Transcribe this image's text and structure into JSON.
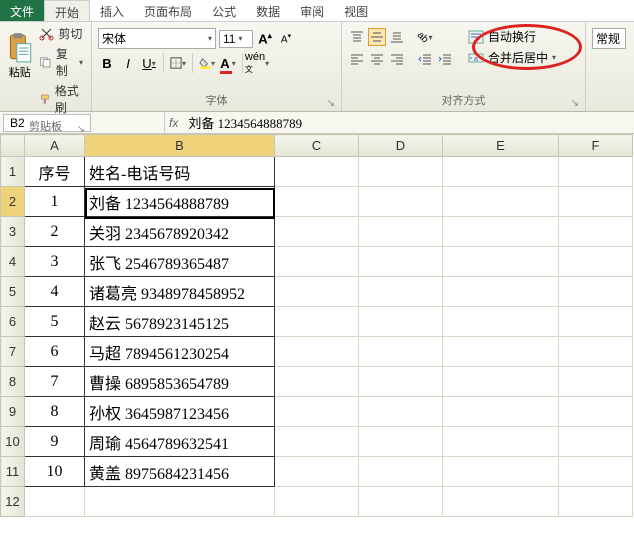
{
  "tabs": {
    "file": "文件",
    "items": [
      "开始",
      "插入",
      "页面布局",
      "公式",
      "数据",
      "审阅",
      "视图"
    ],
    "active_index": 0
  },
  "ribbon": {
    "clipboard": {
      "paste": "粘贴",
      "cut": "剪切",
      "copy": "复制",
      "format_painter": "格式刷",
      "group_label": "剪贴板"
    },
    "font": {
      "font_name": "宋体",
      "font_size": "11",
      "bold": "B",
      "italic": "I",
      "underline": "U",
      "grow": "A",
      "shrink": "A",
      "group_label": "字体"
    },
    "alignment": {
      "wrap_text": "自动换行",
      "merge_center": "合并后居中",
      "group_label": "对齐方式"
    },
    "number": {
      "general": "常规"
    }
  },
  "formula_bar": {
    "name_box": "B2",
    "fx": "fx",
    "value": "刘备 1234564888789"
  },
  "columns": [
    "A",
    "B",
    "C",
    "D",
    "E",
    "F"
  ],
  "row_headers": [
    "1",
    "2",
    "3",
    "4",
    "5",
    "6",
    "7",
    "8",
    "9",
    "10",
    "11",
    "12"
  ],
  "chart_data": {
    "type": "table",
    "headers": {
      "A": "序号",
      "B": "姓名-电话号码"
    },
    "rows": [
      {
        "A": "1",
        "B": "刘备 1234564888789"
      },
      {
        "A": "2",
        "B": "关羽 2345678920342"
      },
      {
        "A": "3",
        "B": "张飞 2546789365487"
      },
      {
        "A": "4",
        "B": "诸葛亮 9348978458952"
      },
      {
        "A": "5",
        "B": "赵云 5678923145125"
      },
      {
        "A": "6",
        "B": "马超 7894561230254"
      },
      {
        "A": "7",
        "B": "曹操 6895853654789"
      },
      {
        "A": "8",
        "B": "孙权 3645987123456"
      },
      {
        "A": "9",
        "B": "周瑜 4564789632541"
      },
      {
        "A": "10",
        "B": "黄盖 8975684231456"
      }
    ]
  },
  "active_cell": "B2"
}
